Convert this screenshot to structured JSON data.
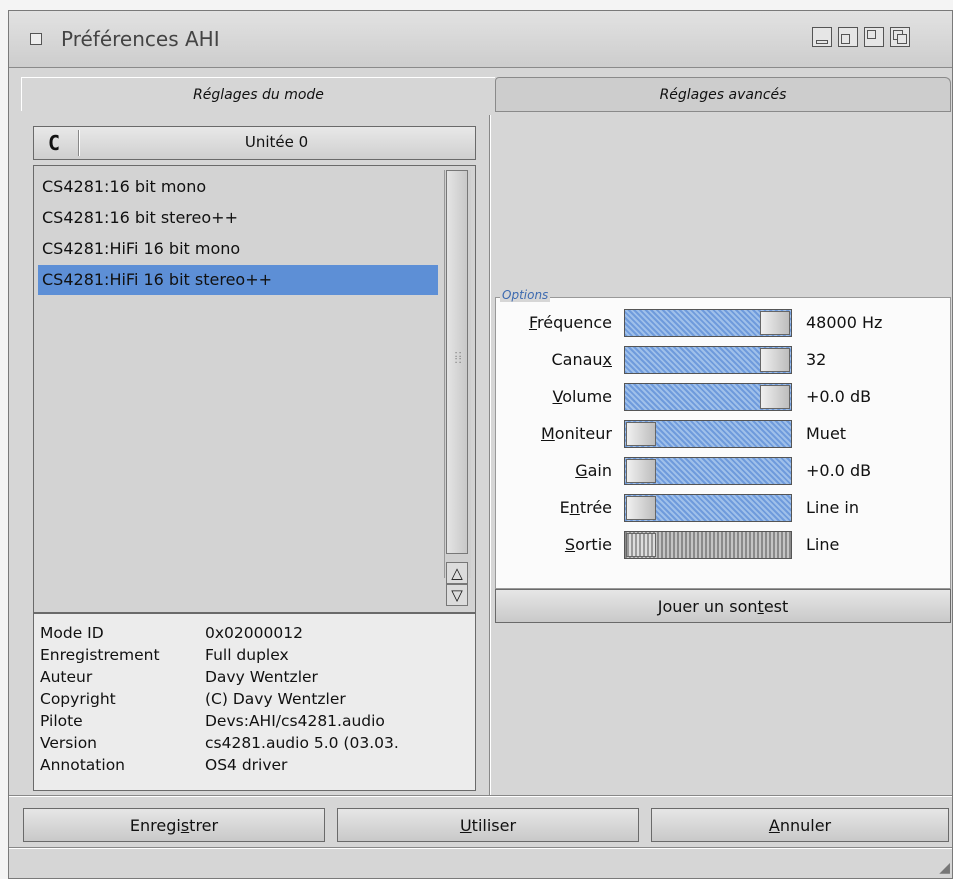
{
  "window": {
    "title": "Préférences AHI"
  },
  "tabs": [
    {
      "label": "Réglages du mode",
      "active": true
    },
    {
      "label": "Réglages avancés",
      "active": false
    }
  ],
  "unit": {
    "label": "Unitée 0",
    "cycle_icon": "C"
  },
  "modes": [
    {
      "label": "CS4281:16 bit mono",
      "selected": false
    },
    {
      "label": "CS4281:16 bit stereo++",
      "selected": false
    },
    {
      "label": "CS4281:HiFi 16 bit mono",
      "selected": false
    },
    {
      "label": "CS4281:HiFi 16 bit stereo++",
      "selected": true
    }
  ],
  "scrollbar": {
    "up_arrow": "△",
    "down_arrow": "▽"
  },
  "info": [
    {
      "key": "Mode ID",
      "value": "0x02000012"
    },
    {
      "key": "Enregistrement",
      "value": "Full duplex"
    },
    {
      "key": "Auteur",
      "value": "Davy Wentzler"
    },
    {
      "key": "Copyright",
      "value": "(C) Davy Wentzler"
    },
    {
      "key": "Pilote",
      "value": "Devs:AHI/cs4281.audio"
    },
    {
      "key": "Version",
      "value": "cs4281.audio 5.0 (03.03."
    },
    {
      "key": "Annotation",
      "value": "OS4 driver"
    }
  ],
  "options": {
    "legend": "Options",
    "rows": [
      {
        "label_pre": "",
        "label_key": "F",
        "label_post": "réquence",
        "value": "48000 Hz",
        "level": 1.0
      },
      {
        "label_pre": "Canau",
        "label_key": "x",
        "label_post": "",
        "value": "32",
        "level": 1.0
      },
      {
        "label_pre": "",
        "label_key": "V",
        "label_post": "olume",
        "value": "+0.0 dB",
        "level": 1.0
      },
      {
        "label_pre": "",
        "label_key": "M",
        "label_post": "oniteur",
        "value": "Muet",
        "level": 0.0
      },
      {
        "label_pre": "",
        "label_key": "G",
        "label_post": "ain",
        "value": "+0.0 dB",
        "level": 0.0
      },
      {
        "label_pre": "E",
        "label_key": "n",
        "label_post": "trée",
        "value": "Line in",
        "level": 0.0
      },
      {
        "label_pre": "",
        "label_key": "S",
        "label_post": "ortie",
        "value": "Line",
        "level": 0.0
      }
    ]
  },
  "test_button": {
    "pre": "Jouer un son ",
    "key": "t",
    "post": "est"
  },
  "bottom_buttons": {
    "save": {
      "pre": "Enregi",
      "key": "s",
      "post": "trer"
    },
    "use": {
      "pre": "",
      "key": "U",
      "post": "tiliser"
    },
    "cancel": {
      "pre": "",
      "key": "A",
      "post": "nnuler"
    }
  }
}
